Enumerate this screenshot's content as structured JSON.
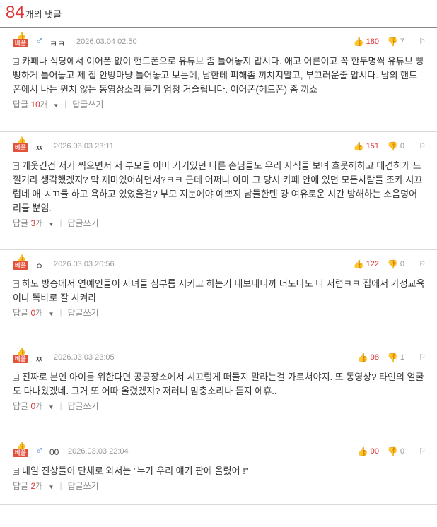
{
  "header": {
    "count": "84",
    "label": "개의 댓글"
  },
  "labels": {
    "reply": "답글",
    "reply_unit": "개",
    "write_reply": "답글쓰기",
    "best": "베플",
    "report_icon": "⚐"
  },
  "comments": [
    {
      "gender": "♂",
      "nick": "ㅋㅋ",
      "date": "2026.03.04 02:50",
      "text": "카페나 식당에서 이어폰 없이 핸드폰으로 유튜브 좀 틀어놓지 맙시다. 애고 어른이고 꼭 한두명씩 유튜브 빵빵하게 틀어놓고 제 집 안방마냥 틀어놓고 보는데, 남한테 피해좀 끼치지말고, 부끄러운줄 압시다. 남의 핸드폰에서 나는 원치 않는 동영상소리 듣기 엄청 거슬립니다. 이어폰(헤드폰) 좀 끼쇼",
      "up": "180",
      "down": "7",
      "replies": "10"
    },
    {
      "gender": "",
      "nick": "ㅉ",
      "date": "2026.03.03 23:11",
      "text": "개웃긴건 저거 찍으면서 저 부모들 아마 거기있던 다른 손님들도 우리 자식들 보며 흐뭇해하고 대견하게 느낄거라 생각했겠지? 막 재미있어하면서?ㅋㅋ 근데 어쩌나 아마 그 당시 카페 안에 있던 모든사람들 조카 시끄럽네 애 ㅅㄲ들 하고 욕하고 있었을걸? 부모 지눈에야 예쁘지 남들한텐 걍 여유로운 시간 방해하는 소음덩어리들 뿐임.",
      "up": "151",
      "down": "0",
      "replies": "3"
    },
    {
      "gender": "",
      "nick": "ㅇ",
      "date": "2026.03.03 20:56",
      "text": "하도 방송에서 연예인들이 자녀들 심부름 시키고 하는거 내보내니까 너도나도 다 저럼ㅋㅋ 집에서 가정교육이나 똑바로 잘 시켜라",
      "up": "122",
      "down": "0",
      "replies": "0"
    },
    {
      "gender": "",
      "nick": "ㅉ",
      "date": "2026.03.03 23:05",
      "text": "진짜로 본인 아이를 위한다면 공공장소에서 시끄럽게 떠들지 말라는걸 가르쳐야지. 또 동영상? 타인의 얼굴도 다나왔겠네. 그거 또 어따 올렸겠지? 저러니 맘충소리나 듣지 에휴..",
      "up": "98",
      "down": "1",
      "replies": "0"
    },
    {
      "gender": "♂",
      "nick": "00",
      "date": "2026.03.03 22:04",
      "text": "내일 진상들이 단체로 와서는 \"누가 우리 얘기 판에 올렸어 !\"",
      "up": "90",
      "down": "0",
      "replies": "2"
    }
  ]
}
